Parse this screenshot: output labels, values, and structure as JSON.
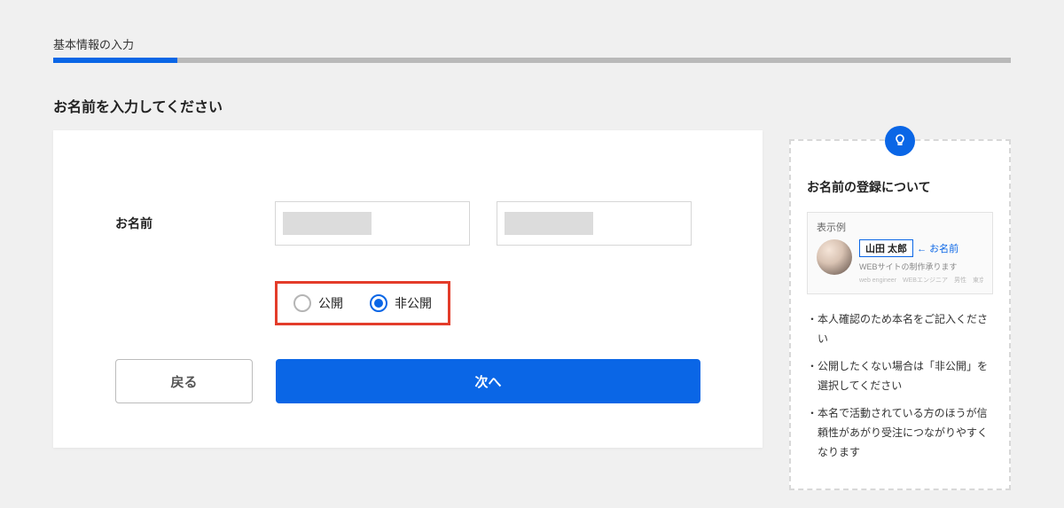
{
  "progress": {
    "label": "基本情報の入力"
  },
  "heading": "お名前を入力してください",
  "form": {
    "name_label": "お名前",
    "radio_public": "公開",
    "radio_private": "非公開"
  },
  "buttons": {
    "back": "戻る",
    "next": "次へ"
  },
  "side": {
    "title": "お名前の登録について",
    "example_caption": "表示例",
    "example_name": "山田 太郎",
    "example_pointer": "← お名前",
    "example_sub": "WEBサイトの制作承ります",
    "example_tags": "web engineer　WEBエンジニア　男性　東京都",
    "tips": [
      "本人確認のため本名をご記入ください",
      "公開したくない場合は「非公開」を選択してください",
      "本名で活動されている方のほうが信頼性があがり受注につながりやすくなります"
    ]
  }
}
